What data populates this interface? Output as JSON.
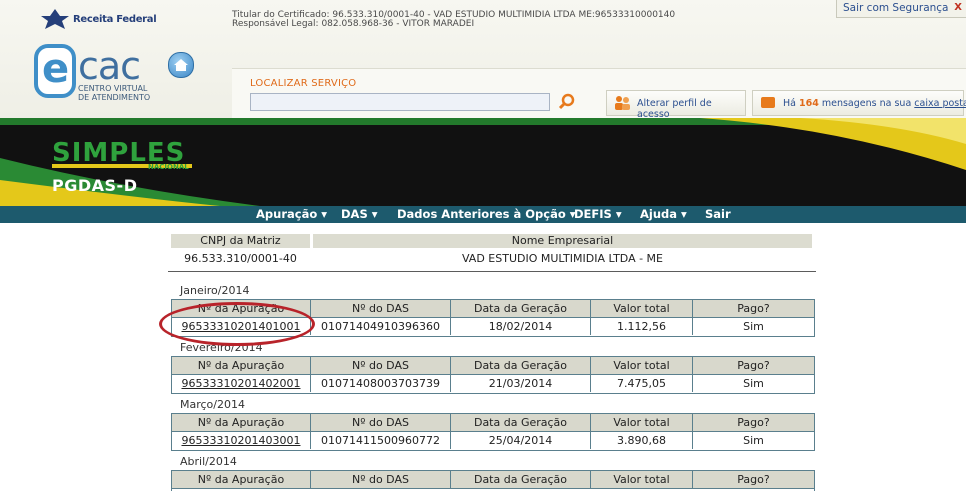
{
  "header": {
    "receita_label": "Receita Federal",
    "ecac_cac": "cac",
    "ecac_e": "e",
    "ecac_sub_1": "CENTRO VIRTUAL",
    "ecac_sub_2": "DE ATENDIMENTO",
    "cert_line1": "Titular do Certificado: 96.533.310/0001-40 - VAD ESTUDIO MULTIMIDIA LTDA ME:96533310000140",
    "cert_line2": "Responsável Legal: 082.058.968-36 - VITOR MARADEI",
    "secure_exit": "Sair com Segurança",
    "secure_exit_x": "X",
    "search_label": "LOCALIZAR SERVIÇO",
    "search_value": "",
    "profile_btn": "Alterar perfil de acesso",
    "msg_prefix": "Há ",
    "msg_count": "164",
    "msg_middle": " mensagens na sua ",
    "msg_link": "caixa postal"
  },
  "banner": {
    "simples": "SIMPLES",
    "nacional": "NACIONAL",
    "pgdas": "PGDAS-D"
  },
  "nav": {
    "items": [
      "Apuração ▾",
      "DAS ▾",
      "Dados Anteriores à Opção ▾",
      "DEFIS ▾",
      "Ajuda ▾",
      "Sair"
    ]
  },
  "company": {
    "cnpj_header": "CNPJ da Matriz",
    "name_header": "Nome Empresarial",
    "cnpj": "96.533.310/0001-40",
    "name": "VAD ESTUDIO MULTIMIDIA LTDA - ME"
  },
  "columns": [
    "Nº da Apuração",
    "Nº do DAS",
    "Data da Geração",
    "Valor total",
    "Pago?"
  ],
  "months": [
    {
      "label": "Janeiro/2014",
      "row": [
        "96533310201401001",
        "01071404910396360",
        "18/02/2014",
        "1.112,56",
        "Sim"
      ]
    },
    {
      "label": "Fevereiro/2014",
      "row": [
        "96533310201402001",
        "01071408003703739",
        "21/03/2014",
        "7.475,05",
        "Sim"
      ]
    },
    {
      "label": "Março/2014",
      "row": [
        "96533310201403001",
        "01071411500960772",
        "25/04/2014",
        "3.890,68",
        "Sim"
      ]
    },
    {
      "label": "Abril/2014",
      "row": null
    }
  ],
  "colors": {
    "nav_bg": "#1d5a6d",
    "highlight_circle": "#b8232a",
    "accent_orange": "#e06b1a"
  }
}
